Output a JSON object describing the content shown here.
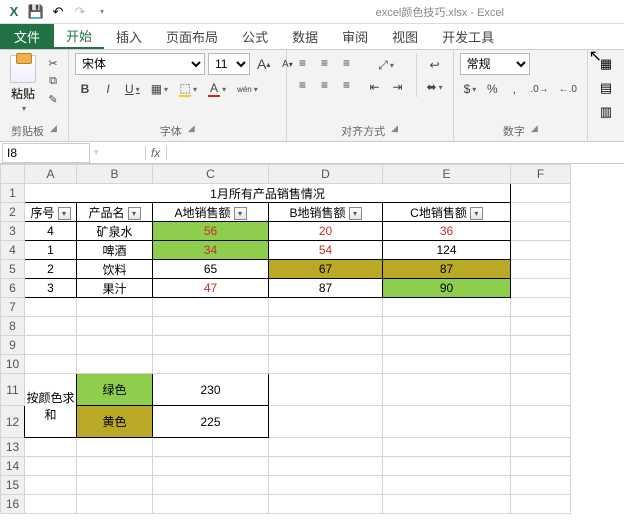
{
  "app": {
    "title": "excel颜色技巧.xlsx - Excel"
  },
  "qat": {
    "excel": "X",
    "save": "💾",
    "undo": "↶",
    "redo": "↷"
  },
  "tabs": {
    "file": "文件",
    "home": "开始",
    "insert": "插入",
    "layout": "页面布局",
    "formulas": "公式",
    "data": "数据",
    "review": "审阅",
    "view": "视图",
    "dev": "开发工具"
  },
  "ribbon": {
    "clipboard": {
      "paste": "粘贴",
      "label": "剪贴板"
    },
    "font": {
      "name": "宋体",
      "size": "11",
      "bold": "B",
      "italic": "I",
      "underline": "U",
      "grow": "A",
      "shrink": "A",
      "label": "字体"
    },
    "align": {
      "wrap": "↩",
      "merge": "⬌",
      "label": "对齐方式"
    },
    "number": {
      "format": "常规",
      "label": "数字"
    }
  },
  "namebox": {
    "ref": "I8"
  },
  "sheet": {
    "cols": [
      "A",
      "B",
      "C",
      "D",
      "E",
      "F"
    ],
    "rows": [
      "1",
      "2",
      "3",
      "4",
      "5",
      "6",
      "7",
      "8",
      "9",
      "10",
      "11",
      "12",
      "13",
      "14",
      "15",
      "16"
    ],
    "title": "1月所有产品销售情况",
    "headers": {
      "no": "序号",
      "name": "产品名",
      "c": "A地销售额",
      "d": "B地销售额",
      "e": "C地销售额"
    },
    "data": [
      {
        "no": "4",
        "name": "矿泉水",
        "c": "56",
        "d": "20",
        "e": "36",
        "cCls": "green redtxt",
        "dCls": "redtxt",
        "eCls": "redtxt"
      },
      {
        "no": "1",
        "name": "啤酒",
        "c": "34",
        "d": "54",
        "e": "124",
        "cCls": "green redtxt",
        "dCls": "redtxt",
        "eCls": ""
      },
      {
        "no": "2",
        "name": "饮料",
        "c": "65",
        "d": "67",
        "e": "87",
        "cCls": "",
        "dCls": "yellow",
        "eCls": "yellow"
      },
      {
        "no": "3",
        "name": "果汁",
        "c": "47",
        "d": "87",
        "e": "90",
        "cCls": "redtxt",
        "dCls": "",
        "eCls": "green"
      }
    ],
    "sum": {
      "label": "按颜色求和",
      "green_label": "绿色",
      "green_val": "230",
      "yellow_label": "黄色",
      "yellow_val": "225"
    }
  }
}
